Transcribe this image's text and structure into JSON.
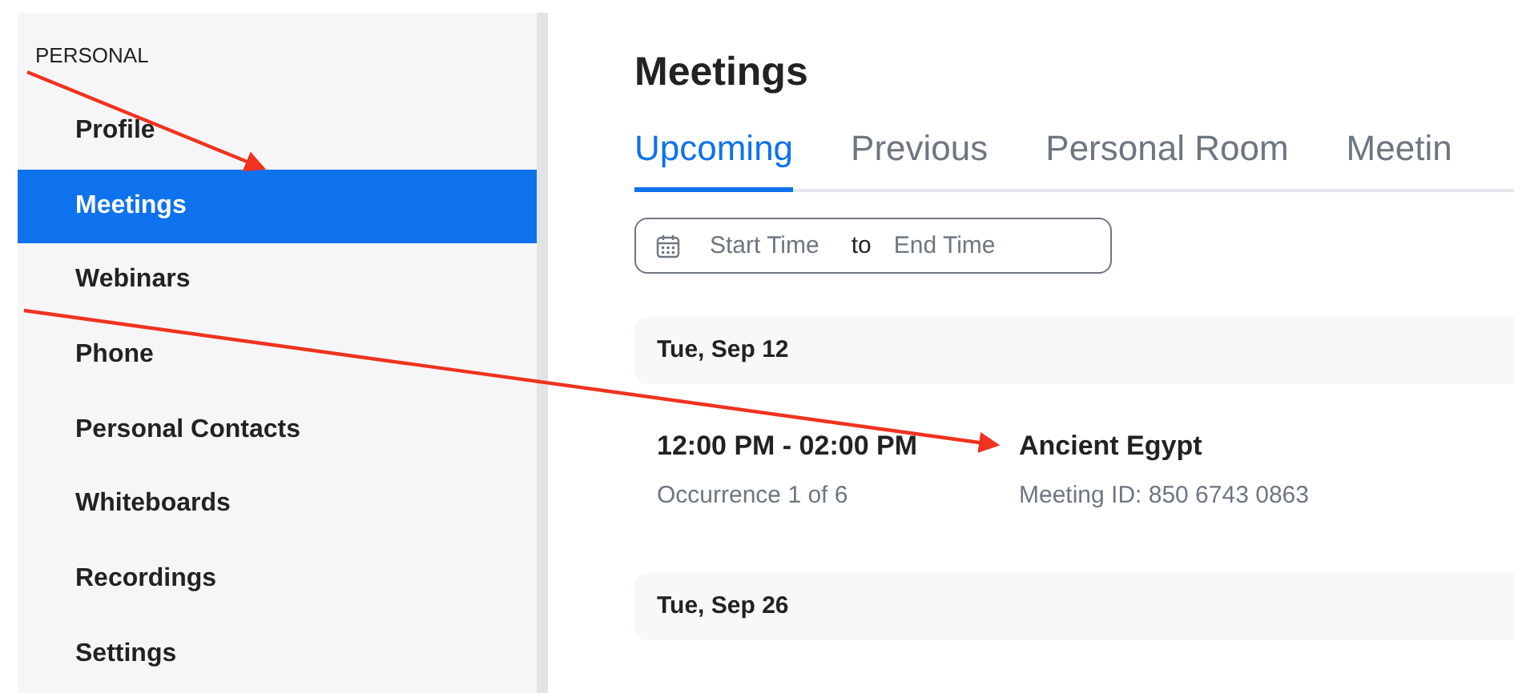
{
  "sidebar": {
    "section": "PERSONAL",
    "items": [
      {
        "label": "Profile",
        "selected": false
      },
      {
        "label": "Meetings",
        "selected": true
      },
      {
        "label": "Webinars",
        "selected": false
      },
      {
        "label": "Phone",
        "selected": false
      },
      {
        "label": "Personal Contacts",
        "selected": false
      },
      {
        "label": "Whiteboards",
        "selected": false
      },
      {
        "label": "Recordings",
        "selected": false
      },
      {
        "label": "Settings",
        "selected": false
      }
    ]
  },
  "main": {
    "title": "Meetings",
    "tabs": [
      {
        "label": "Upcoming",
        "selected": true
      },
      {
        "label": "Previous",
        "selected": false
      },
      {
        "label": "Personal Room",
        "selected": false
      },
      {
        "label": "Meetin",
        "selected": false
      }
    ],
    "date_filter": {
      "start_placeholder": "Start Time",
      "separator": "to",
      "end_placeholder": "End Time"
    },
    "days": [
      {
        "date": "Tue, Sep 12",
        "meetings": [
          {
            "time": "12:00 PM - 02:00 PM",
            "occurrence": "Occurrence 1 of 6",
            "title": "Ancient Egypt",
            "meeting_id": "Meeting ID: 850 6743 0863"
          }
        ]
      },
      {
        "date": "Tue, Sep 26"
      }
    ]
  }
}
